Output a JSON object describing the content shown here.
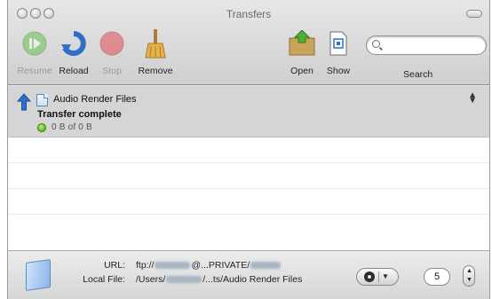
{
  "window": {
    "title": "Transfers"
  },
  "toolbar": {
    "buttons": [
      {
        "label": "Resume",
        "icon": "resume-icon",
        "enabled": false
      },
      {
        "label": "Reload",
        "icon": "reload-icon",
        "enabled": true
      },
      {
        "label": "Stop",
        "icon": "stop-icon",
        "enabled": false
      },
      {
        "label": "Remove",
        "icon": "broom-icon",
        "enabled": true
      },
      {
        "label": "Open",
        "icon": "open-folder-icon",
        "enabled": true
      },
      {
        "label": "Show",
        "icon": "show-file-icon",
        "enabled": true
      }
    ],
    "search": {
      "label": "Search",
      "placeholder": "",
      "value": ""
    }
  },
  "transfers": [
    {
      "direction": "upload",
      "name": "Audio Render Files",
      "status": "Transfer complete",
      "progress": "0 B of 0 B",
      "progress_fraction": 1.0,
      "selected": true
    }
  ],
  "info": {
    "url_label": "URL:",
    "url_prefix": "ftp://",
    "url_middle": "@...",
    "url_suffix": "PRIVATE/",
    "local_label": "Local File:",
    "local_prefix": "/Users/",
    "local_suffix": "/...ts/Audio Render Files",
    "connection_limit": "5"
  },
  "colors": {
    "selection": "#d5d5d5",
    "complete": "#3f9d1a",
    "upload_arrow": "#2f6fc9"
  }
}
